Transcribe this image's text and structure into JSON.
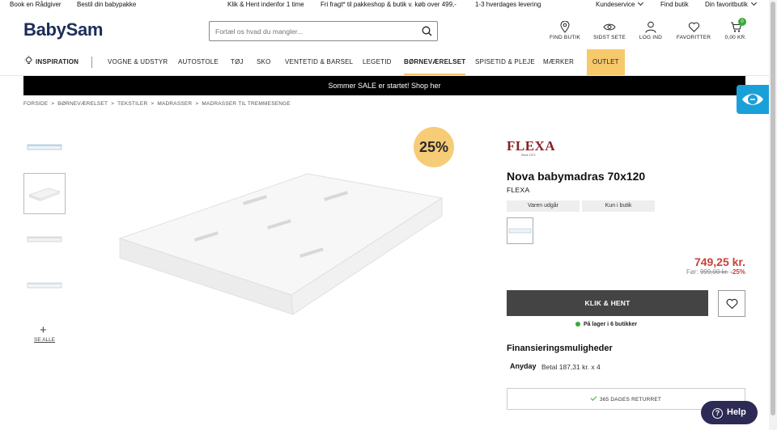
{
  "topbar": {
    "book_advisor": "Book en Rådgiver",
    "order_package": "Bestil din babypakke",
    "click_collect": "Klik & Hent indenfor 1 time",
    "free_shipping": "Fri fragt* til pakkeshop & butik v. køb over 499,-",
    "delivery": "1-3 hverdages levering",
    "customer_service": "Kundeservice",
    "find_store": "Find butik",
    "your_store": "Din favoritbutik"
  },
  "header": {
    "logo": "BabySam",
    "search_placeholder": "Fortæl os hvad du mangler...",
    "find_store": "FIND BUTIK",
    "recently_viewed": "SIDST SETE",
    "login": "LOG IND",
    "favorites": "FAVORITTER",
    "cart_total": "0,00 KR.",
    "cart_count": "0"
  },
  "nav": {
    "inspiration": "INSPIRATION",
    "items": [
      "VOGNE & UDSTYR",
      "AUTOSTOLE",
      "TØJ",
      "SKO",
      "VENTETID & BARSEL",
      "LEGETID",
      "BØRNEVÆRELSET",
      "SPISETID & PLEJE",
      "MÆRKER",
      "OUTLET"
    ]
  },
  "banner": "Sommer SALE er startet! Shop her",
  "breadcrumb": [
    "FORSIDE",
    ">",
    "BØRNEVÆRELSET",
    ">",
    "TEKSTILER",
    ">",
    "MADRASSER",
    ">",
    "MADRASSER TIL TREMMESENGE"
  ],
  "gallery": {
    "see_all": "SE ALLE"
  },
  "product": {
    "discount_badge": "25%",
    "brand_logo": "FLEXA",
    "brand_logo_sub": "Since 1972",
    "title": "Nova babymadras 70x120",
    "brand": "FLEXA",
    "tag_online": "Varen udgår",
    "tag_store": "Kun i butik",
    "price": "749,25 kr.",
    "old_label": "Før:",
    "old_price": "999,00 kr.",
    "old_discount": "-25%",
    "cta": "KLIK & HENT",
    "stock": "På lager i 6 butikker",
    "financing_title": "Finansieringsmuligheder",
    "anyday_logo": "Anyday",
    "installment": "Betal 187,31 kr. x 4",
    "returns": "365 DAGES RETURRET"
  },
  "help": "Help",
  "colors": {
    "accent": "#f6c96a",
    "brand": "#1c2d57",
    "price": "#c9413a",
    "stock": "#3aaa35"
  }
}
